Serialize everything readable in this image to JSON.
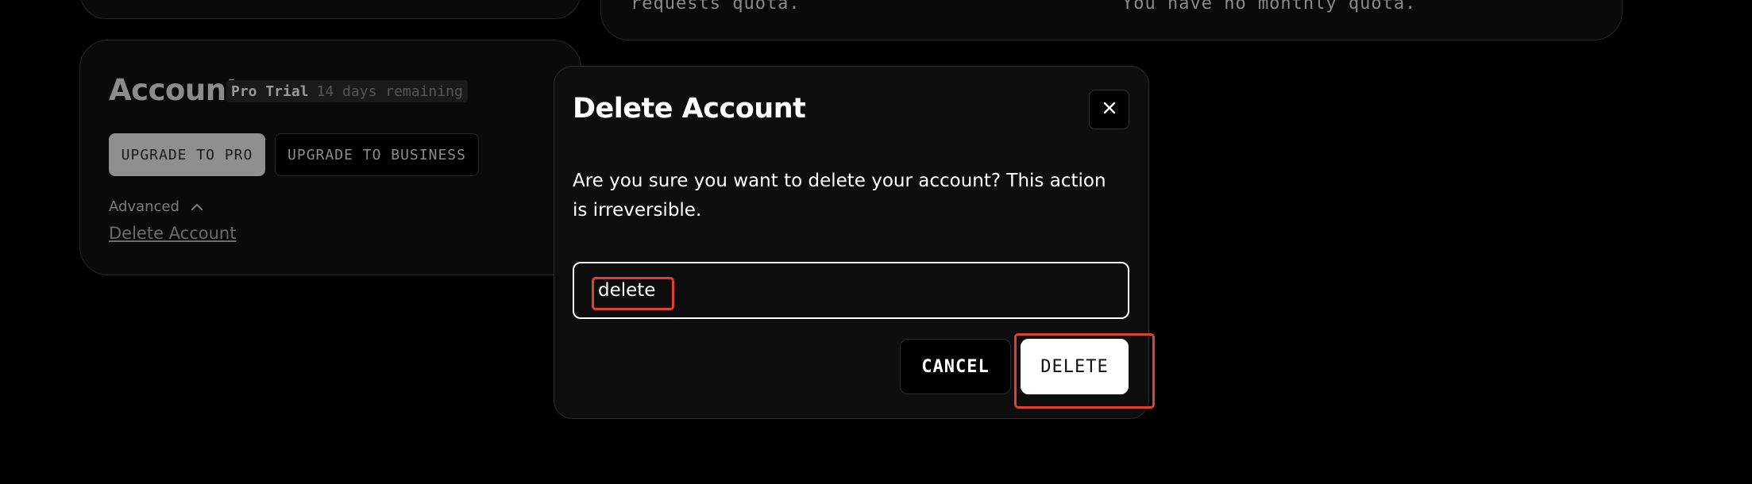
{
  "background_cards": {
    "quota_left": "requests quota.",
    "quota_right": "You have no monthly quota."
  },
  "account": {
    "title": "Account",
    "plan_name": "Pro Trial",
    "plan_remaining": "14 days remaining",
    "upgrade_pro_label": "UPGRADE TO PRO",
    "upgrade_business_label": "UPGRADE TO BUSINESS",
    "advanced_label": "Advanced",
    "advanced_icon": "chevron-up-icon",
    "delete_account_link": "Delete Account"
  },
  "modal": {
    "title": "Delete Account",
    "close_icon": "close-icon",
    "message": "Are you sure you want to delete your account? This action is irreversible.",
    "confirm_input_value": "delete",
    "cancel_label": "CANCEL",
    "delete_label": "DELETE"
  },
  "colors": {
    "page_background": "#000000",
    "modal_background": "#0e0e0e",
    "highlight": "#e0412f",
    "primary_button": "#ffffff"
  }
}
